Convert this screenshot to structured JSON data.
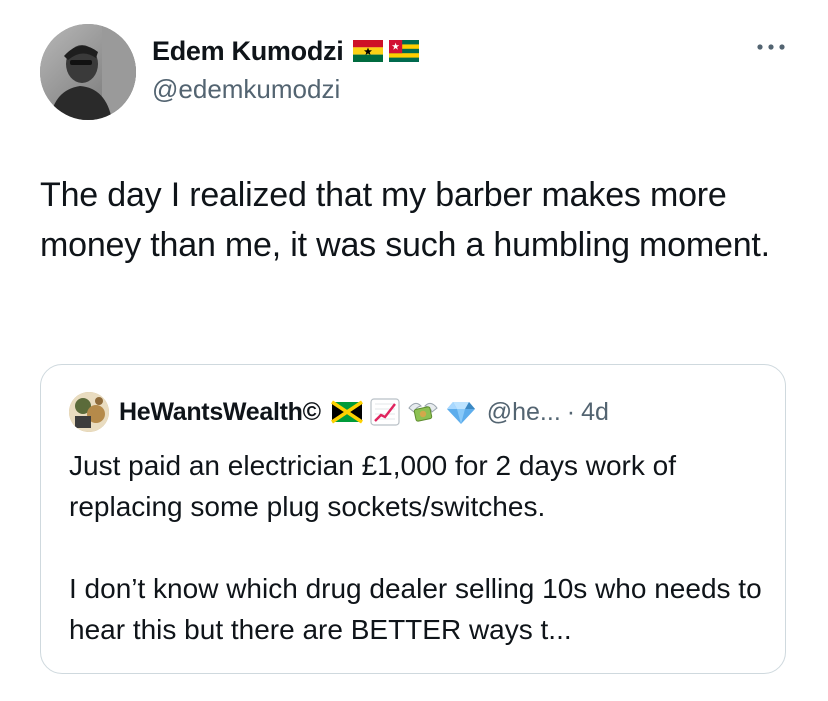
{
  "tweet": {
    "author": {
      "display_name": "Edem Kumodzi",
      "handle": "@edemkumodzi",
      "flags": [
        "ghana-flag-icon",
        "togo-flag-icon"
      ]
    },
    "more_icon": "more-horizontal-icon",
    "text": "The day I realized that my barber makes more money than me, it was such a humbling moment."
  },
  "quote": {
    "author": {
      "display_name": "HeWantsWealth©",
      "handle": "@he...",
      "emojis": [
        "jamaica-flag-icon",
        "chart-increasing-icon",
        "money-with-wings-icon",
        "gem-icon"
      ]
    },
    "separator": "·",
    "time": "4d",
    "text": "Just paid an electrician £1,000 for 2 days work of replacing some plug sockets/switches.\n\nI don’t know which drug dealer selling 10s who needs to hear this but there are BETTER ways t..."
  },
  "colors": {
    "text_primary": "#0f1419",
    "text_secondary": "#536471",
    "border": "#cfd9de"
  }
}
